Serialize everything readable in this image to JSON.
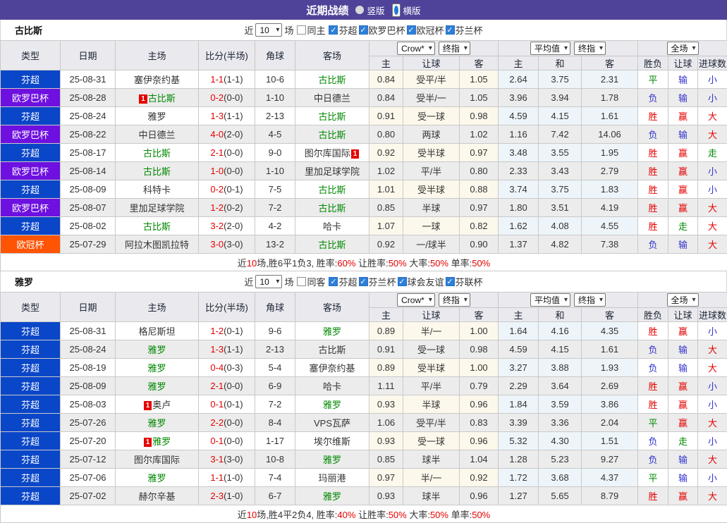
{
  "titlebar": {
    "title": "近期战绩",
    "options": [
      {
        "label": "竖版",
        "selected": false
      },
      {
        "label": "横版",
        "selected": true
      }
    ]
  },
  "table_header": {
    "cols": [
      "类型",
      "日期",
      "主场",
      "比分(半场)",
      "角球",
      "客场"
    ],
    "sub": [
      "主",
      "让球",
      "客",
      "主",
      "和",
      "客",
      "胜负",
      "让球",
      "进球数"
    ],
    "selects": {
      "bookmaker": "Crow*",
      "stage1": "终指",
      "average": "平均值",
      "stage2": "终指",
      "scope": "全场"
    }
  },
  "palette": {
    "titlebar_bg": "#4f4399",
    "win_red": "#e60000",
    "lose_blue": "#3333cc",
    "draw_green": "#008800"
  },
  "league_colors": {
    "芬超": "#0a46c8",
    "欧罗巴杯": "#6e10e0",
    "欧冠杯": "#ff5404"
  },
  "result_colors": {
    "胜": "red",
    "平": "green",
    "负": "blue",
    "赢": "red",
    "输": "blue",
    "走": "green",
    "大": "red",
    "小": "blue"
  },
  "sections": [
    {
      "team": "古比斯",
      "filter": {
        "prefix": "近",
        "count": "10",
        "suffix": "场",
        "same": {
          "label": "同主",
          "checked": false
        },
        "leagues": [
          {
            "label": "芬超",
            "checked": true
          },
          {
            "label": "欧罗巴杯",
            "checked": true
          },
          {
            "label": "欧冠杯",
            "checked": true
          },
          {
            "label": "芬兰杯",
            "checked": true
          }
        ]
      },
      "rows": [
        {
          "lg": "芬超",
          "date": "25-08-31",
          "home": {
            "n": "塞伊奈约基"
          },
          "score": "1-1",
          "half": "(1-1)",
          "corner": "10-6",
          "away": {
            "n": "古比斯",
            "hl": true
          },
          "h1": "0.84",
          "hd": "受平/半",
          "h2": "1.05",
          "e1": "2.64",
          "e2": "3.75",
          "e3": "2.31",
          "wdl": "平",
          "ah": "输",
          "ou": "小"
        },
        {
          "lg": "欧罗巴杯",
          "date": "25-08-28",
          "home": {
            "n": "古比斯",
            "hl": true,
            "cb": "1"
          },
          "score": "0-2",
          "half": "(0-0)",
          "corner": "1-10",
          "away": {
            "n": "中日德兰"
          },
          "h1": "0.84",
          "hd": "受半/一",
          "h2": "1.05",
          "e1": "3.96",
          "e2": "3.94",
          "e3": "1.78",
          "wdl": "负",
          "ah": "输",
          "ou": "小"
        },
        {
          "lg": "芬超",
          "date": "25-08-24",
          "home": {
            "n": "雅罗"
          },
          "score": "1-3",
          "half": "(1-1)",
          "corner": "2-13",
          "away": {
            "n": "古比斯",
            "hl": true
          },
          "h1": "0.91",
          "hd": "受一球",
          "h2": "0.98",
          "e1": "4.59",
          "e2": "4.15",
          "e3": "1.61",
          "wdl": "胜",
          "ah": "赢",
          "ou": "大"
        },
        {
          "lg": "欧罗巴杯",
          "date": "25-08-22",
          "home": {
            "n": "中日德兰"
          },
          "score": "4-0",
          "half": "(2-0)",
          "corner": "4-5",
          "away": {
            "n": "古比斯",
            "hl": true
          },
          "h1": "0.80",
          "hd": "两球",
          "h2": "1.02",
          "e1": "1.16",
          "e2": "7.42",
          "e3": "14.06",
          "wdl": "负",
          "ah": "输",
          "ou": "大"
        },
        {
          "lg": "芬超",
          "date": "25-08-17",
          "home": {
            "n": "古比斯",
            "hl": true
          },
          "score": "2-1",
          "half": "(0-0)",
          "corner": "9-0",
          "away": {
            "n": "图尔库国际",
            "ca": "1"
          },
          "h1": "0.92",
          "hd": "受半球",
          "h2": "0.97",
          "e1": "3.48",
          "e2": "3.55",
          "e3": "1.95",
          "wdl": "胜",
          "ah": "赢",
          "ou": "走"
        },
        {
          "lg": "欧罗巴杯",
          "date": "25-08-14",
          "home": {
            "n": "古比斯",
            "hl": true
          },
          "score": "1-0",
          "half": "(0-0)",
          "corner": "1-10",
          "away": {
            "n": "里加足球学院"
          },
          "h1": "1.02",
          "hd": "平/半",
          "h2": "0.80",
          "e1": "2.33",
          "e2": "3.43",
          "e3": "2.79",
          "wdl": "胜",
          "ah": "赢",
          "ou": "小"
        },
        {
          "lg": "芬超",
          "date": "25-08-09",
          "home": {
            "n": "科特卡"
          },
          "score": "0-2",
          "half": "(0-1)",
          "corner": "7-5",
          "away": {
            "n": "古比斯",
            "hl": true
          },
          "h1": "1.01",
          "hd": "受半球",
          "h2": "0.88",
          "e1": "3.74",
          "e2": "3.75",
          "e3": "1.83",
          "wdl": "胜",
          "ah": "赢",
          "ou": "小"
        },
        {
          "lg": "欧罗巴杯",
          "date": "25-08-07",
          "home": {
            "n": "里加足球学院"
          },
          "score": "1-2",
          "half": "(0-2)",
          "corner": "7-2",
          "away": {
            "n": "古比斯",
            "hl": true
          },
          "h1": "0.85",
          "hd": "半球",
          "h2": "0.97",
          "e1": "1.80",
          "e2": "3.51",
          "e3": "4.19",
          "wdl": "胜",
          "ah": "赢",
          "ou": "大"
        },
        {
          "lg": "芬超",
          "date": "25-08-02",
          "home": {
            "n": "古比斯",
            "hl": true
          },
          "score": "3-2",
          "half": "(2-0)",
          "corner": "4-2",
          "away": {
            "n": "哈卡"
          },
          "h1": "1.07",
          "hd": "一球",
          "h2": "0.82",
          "e1": "1.62",
          "e2": "4.08",
          "e3": "4.55",
          "wdl": "胜",
          "ah": "走",
          "ou": "大"
        },
        {
          "lg": "欧冠杯",
          "date": "25-07-29",
          "home": {
            "n": "阿拉木图凯拉特"
          },
          "score": "3-0",
          "half": "(3-0)",
          "corner": "13-2",
          "away": {
            "n": "古比斯",
            "hl": true
          },
          "h1": "0.92",
          "hd": "一/球半",
          "h2": "0.90",
          "e1": "1.37",
          "e2": "4.82",
          "e3": "7.38",
          "wdl": "负",
          "ah": "输",
          "ou": "大"
        }
      ],
      "summary": [
        [
          "近",
          "k"
        ],
        [
          "10",
          "r"
        ],
        [
          "场,胜6平1负3, 胜率:",
          "k"
        ],
        [
          "60%",
          "r"
        ],
        [
          " 让胜率:",
          "k"
        ],
        [
          "50%",
          "r"
        ],
        [
          " 大率:",
          "k"
        ],
        [
          "50%",
          "r"
        ],
        [
          " 单率:",
          "k"
        ],
        [
          "50%",
          "r"
        ]
      ]
    },
    {
      "team": "雅罗",
      "filter": {
        "prefix": "近",
        "count": "10",
        "suffix": "场",
        "same": {
          "label": "同客",
          "checked": false
        },
        "leagues": [
          {
            "label": "芬超",
            "checked": true
          },
          {
            "label": "芬兰杯",
            "checked": true
          },
          {
            "label": "球会友谊",
            "checked": true
          },
          {
            "label": "芬联杯",
            "checked": true
          }
        ]
      },
      "rows": [
        {
          "lg": "芬超",
          "date": "25-08-31",
          "home": {
            "n": "格尼斯坦"
          },
          "score": "1-2",
          "half": "(0-1)",
          "corner": "9-6",
          "away": {
            "n": "雅罗",
            "hl": true
          },
          "h1": "0.89",
          "hd": "半/一",
          "h2": "1.00",
          "e1": "1.64",
          "e2": "4.16",
          "e3": "4.35",
          "wdl": "胜",
          "ah": "赢",
          "ou": "小"
        },
        {
          "lg": "芬超",
          "date": "25-08-24",
          "home": {
            "n": "雅罗",
            "hl": true
          },
          "score": "1-3",
          "half": "(1-1)",
          "corner": "2-13",
          "away": {
            "n": "古比斯"
          },
          "h1": "0.91",
          "hd": "受一球",
          "h2": "0.98",
          "e1": "4.59",
          "e2": "4.15",
          "e3": "1.61",
          "wdl": "负",
          "ah": "输",
          "ou": "大"
        },
        {
          "lg": "芬超",
          "date": "25-08-19",
          "home": {
            "n": "雅罗",
            "hl": true
          },
          "score": "0-4",
          "half": "(0-3)",
          "corner": "5-4",
          "away": {
            "n": "塞伊奈约基"
          },
          "h1": "0.89",
          "hd": "受半球",
          "h2": "1.00",
          "e1": "3.27",
          "e2": "3.88",
          "e3": "1.93",
          "wdl": "负",
          "ah": "输",
          "ou": "大"
        },
        {
          "lg": "芬超",
          "date": "25-08-09",
          "home": {
            "n": "雅罗",
            "hl": true
          },
          "score": "2-1",
          "half": "(0-0)",
          "corner": "6-9",
          "away": {
            "n": "哈卡"
          },
          "h1": "1.11",
          "hd": "平/半",
          "h2": "0.79",
          "e1": "2.29",
          "e2": "3.64",
          "e3": "2.69",
          "wdl": "胜",
          "ah": "赢",
          "ou": "小"
        },
        {
          "lg": "芬超",
          "date": "25-08-03",
          "home": {
            "n": "奥卢",
            "cb": "1"
          },
          "score": "0-1",
          "half": "(0-1)",
          "corner": "7-2",
          "away": {
            "n": "雅罗",
            "hl": true
          },
          "h1": "0.93",
          "hd": "半球",
          "h2": "0.96",
          "e1": "1.84",
          "e2": "3.59",
          "e3": "3.86",
          "wdl": "胜",
          "ah": "赢",
          "ou": "小"
        },
        {
          "lg": "芬超",
          "date": "25-07-26",
          "home": {
            "n": "雅罗",
            "hl": true
          },
          "score": "2-2",
          "half": "(0-0)",
          "corner": "8-4",
          "away": {
            "n": "VPS瓦萨"
          },
          "h1": "1.06",
          "hd": "受平/半",
          "h2": "0.83",
          "e1": "3.39",
          "e2": "3.36",
          "e3": "2.04",
          "wdl": "平",
          "ah": "赢",
          "ou": "大"
        },
        {
          "lg": "芬超",
          "date": "25-07-20",
          "home": {
            "n": "雅罗",
            "hl": true,
            "cb": "1"
          },
          "score": "0-1",
          "half": "(0-0)",
          "corner": "1-17",
          "away": {
            "n": "埃尔维斯"
          },
          "h1": "0.93",
          "hd": "受一球",
          "h2": "0.96",
          "e1": "5.32",
          "e2": "4.30",
          "e3": "1.51",
          "wdl": "负",
          "ah": "走",
          "ou": "小"
        },
        {
          "lg": "芬超",
          "date": "25-07-12",
          "home": {
            "n": "图尔库国际"
          },
          "score": "3-1",
          "half": "(3-0)",
          "corner": "10-8",
          "away": {
            "n": "雅罗",
            "hl": true
          },
          "h1": "0.85",
          "hd": "球半",
          "h2": "1.04",
          "e1": "1.28",
          "e2": "5.23",
          "e3": "9.27",
          "wdl": "负",
          "ah": "输",
          "ou": "大"
        },
        {
          "lg": "芬超",
          "date": "25-07-06",
          "home": {
            "n": "雅罗",
            "hl": true
          },
          "score": "1-1",
          "half": "(1-0)",
          "corner": "7-4",
          "away": {
            "n": "玛丽港"
          },
          "h1": "0.97",
          "hd": "半/一",
          "h2": "0.92",
          "e1": "1.72",
          "e2": "3.68",
          "e3": "4.37",
          "wdl": "平",
          "ah": "输",
          "ou": "小"
        },
        {
          "lg": "芬超",
          "date": "25-07-02",
          "home": {
            "n": "赫尔辛基"
          },
          "score": "2-3",
          "half": "(1-0)",
          "corner": "6-7",
          "away": {
            "n": "雅罗",
            "hl": true
          },
          "h1": "0.93",
          "hd": "球半",
          "h2": "0.96",
          "e1": "1.27",
          "e2": "5.65",
          "e3": "8.79",
          "wdl": "胜",
          "ah": "赢",
          "ou": "大"
        }
      ],
      "summary": [
        [
          "近",
          "k"
        ],
        [
          "10",
          "r"
        ],
        [
          "场,胜4平2负4, 胜率:",
          "k"
        ],
        [
          "40%",
          "r"
        ],
        [
          " 让胜率:",
          "k"
        ],
        [
          "50%",
          "r"
        ],
        [
          " 大率:",
          "k"
        ],
        [
          "50%",
          "r"
        ],
        [
          " 单率:",
          "k"
        ],
        [
          "50%",
          "r"
        ]
      ]
    }
  ]
}
